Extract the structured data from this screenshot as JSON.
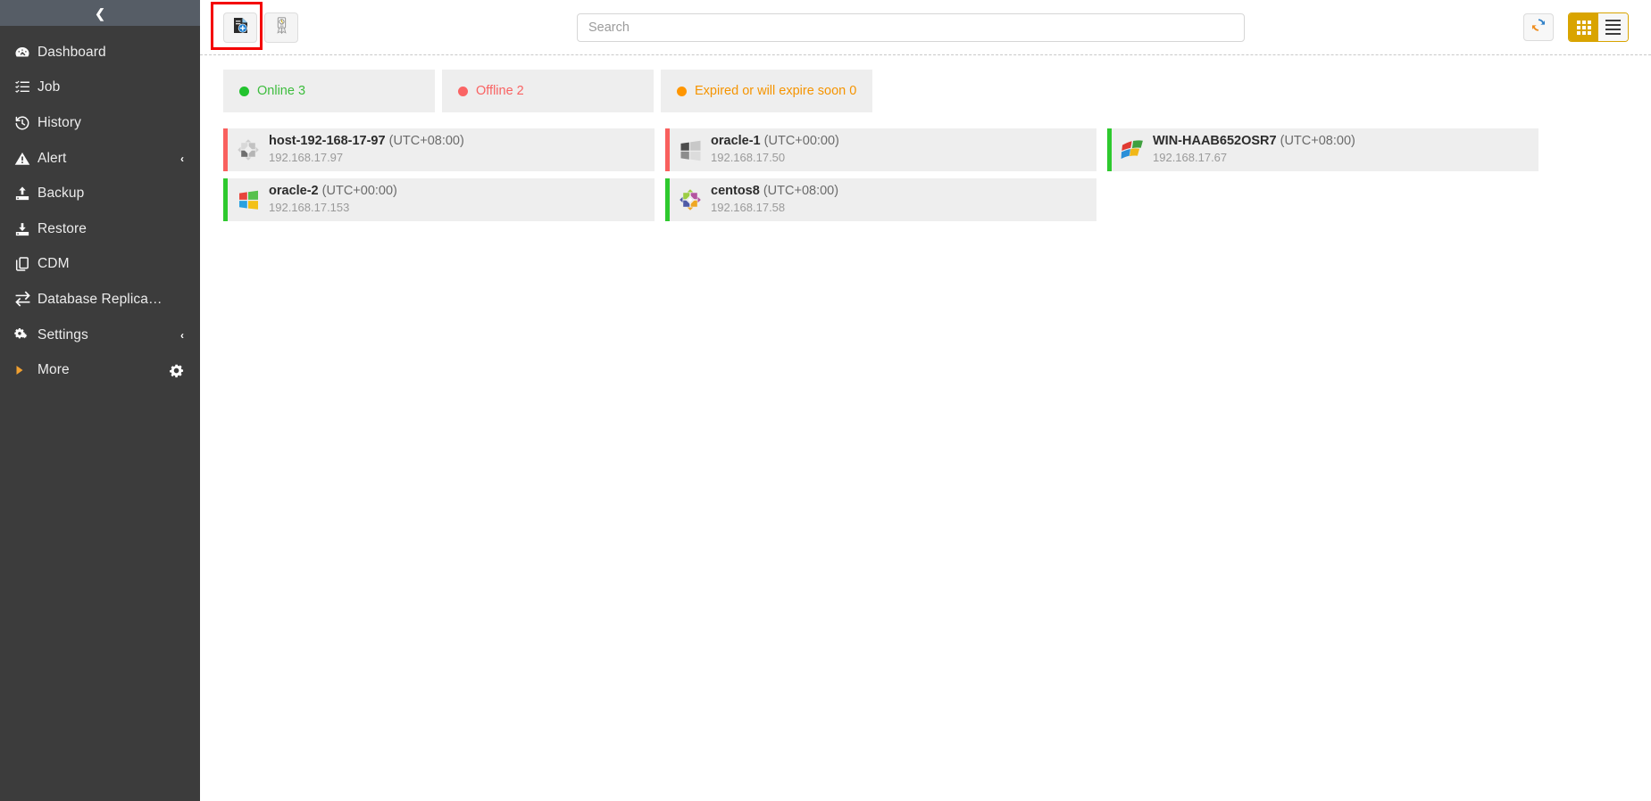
{
  "sidebar": {
    "collapse_icon": "chevron-left-icon",
    "items": [
      {
        "label": "Dashboard",
        "icon": "dashboard-gauge-icon",
        "caret": ""
      },
      {
        "label": "Job",
        "icon": "task-list-icon",
        "caret": ""
      },
      {
        "label": "History",
        "icon": "history-clock-icon",
        "caret": ""
      },
      {
        "label": "Alert",
        "icon": "alert-triangle-icon",
        "caret": "‹"
      },
      {
        "label": "Backup",
        "icon": "backup-upload-icon",
        "caret": ""
      },
      {
        "label": "Restore",
        "icon": "restore-download-icon",
        "caret": ""
      },
      {
        "label": "CDM",
        "icon": "copy-pages-icon",
        "caret": ""
      },
      {
        "label": "Database Replica…",
        "icon": "exchange-arrows-icon",
        "caret": ""
      },
      {
        "label": "Settings",
        "icon": "gears-icon",
        "caret": "‹"
      },
      {
        "label": "More",
        "icon": "triangle-right-icon",
        "caret": "",
        "right_icon": "gear-icon"
      }
    ]
  },
  "toolbar": {
    "add_host_button": "add-file-icon",
    "license_button": "license-badge-icon",
    "refresh_button": "refresh-icon",
    "grid_view_button": "grid-view-icon",
    "list_view_button": "list-view-icon",
    "grid_view_active": true
  },
  "search": {
    "placeholder": "Search",
    "value": ""
  },
  "status_cards": [
    {
      "label": "Online 3",
      "color": "#22c32e",
      "text_color": "#3dbd3d"
    },
    {
      "label": "Offline 2",
      "color": "#fa6464",
      "text_color": "#f96262"
    },
    {
      "label": "Expired or will expire soon 0",
      "color": "#ff9600",
      "text_color": "#f59400"
    }
  ],
  "hosts": [
    {
      "name": "host-192-168-17-97",
      "timezone": "(UTC+08:00)",
      "ip": "192.168.17.97",
      "status_color": "#f9605e",
      "os_icon": "centos-logo-gray-icon",
      "online": false
    },
    {
      "name": "oracle-1",
      "timezone": "(UTC+00:00)",
      "ip": "192.168.17.50",
      "status_color": "#f9605e",
      "os_icon": "windows-logo-gray-icon",
      "online": false
    },
    {
      "name": "WIN-HAAB652OSR7",
      "timezone": "(UTC+08:00)",
      "ip": "192.168.17.67",
      "status_color": "#2ec92e",
      "os_icon": "windows7-flag-icon",
      "online": true
    },
    {
      "name": "oracle-2",
      "timezone": "(UTC+00:00)",
      "ip": "192.168.17.153",
      "status_color": "#2ec92e",
      "os_icon": "windows-logo-color-icon",
      "online": true
    },
    {
      "name": "centos8",
      "timezone": "(UTC+08:00)",
      "ip": "192.168.17.58",
      "status_color": "#2ec92e",
      "os_icon": "centos-logo-color-icon",
      "online": true
    }
  ]
}
